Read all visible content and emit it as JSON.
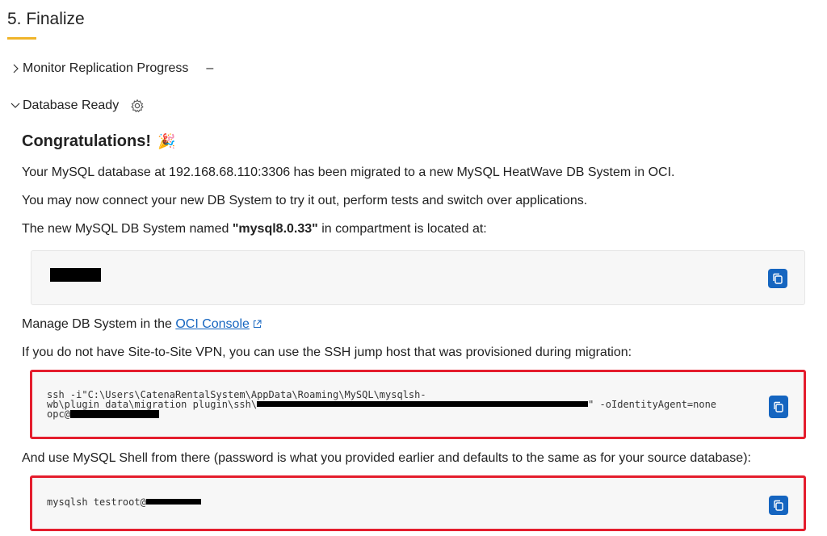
{
  "step": {
    "title": "5. Finalize"
  },
  "sections": {
    "monitor": {
      "label": "Monitor Replication Progress",
      "status": "–"
    },
    "ready": {
      "label": "Database Ready"
    }
  },
  "main": {
    "heading": "Congratulations!",
    "heading_emoji": "🎉",
    "line1": "Your MySQL database at 192.168.68.110:3306 has been migrated to a new MySQL HeatWave DB System in OCI.",
    "line2": "You may now connect your new DB System to try it out, perform tests and switch over applications.",
    "line3_pre": "The new MySQL DB System named ",
    "line3_name": "\"mysql8.0.33\"",
    "line3_post": " in compartment is located at:",
    "manage_pre": "Manage DB System in the ",
    "manage_link": "OCI Console",
    "vpn_text": "If you do not have Site-to-Site VPN, you can use the SSH jump host that was provisioned during migration:",
    "ssh_line1": "ssh -i\"C:\\Users\\CatenaRentalSystem\\AppData\\Roaming\\MySQL\\mysqlsh-",
    "ssh_line2_pre": "wb\\plugin data\\migration plugin\\ssh\\",
    "ssh_line2_post": "\" -oIdentityAgent=none",
    "ssh_line3": "opc@",
    "shell_text": "And use MySQL Shell from there (password is what you provided earlier and defaults to the same as for your source database):",
    "shell_cmd": "mysqlsh testroot@"
  },
  "colors": {
    "accent": "#f0b429",
    "link": "#1565c0",
    "highlight": "#e41d2d"
  }
}
